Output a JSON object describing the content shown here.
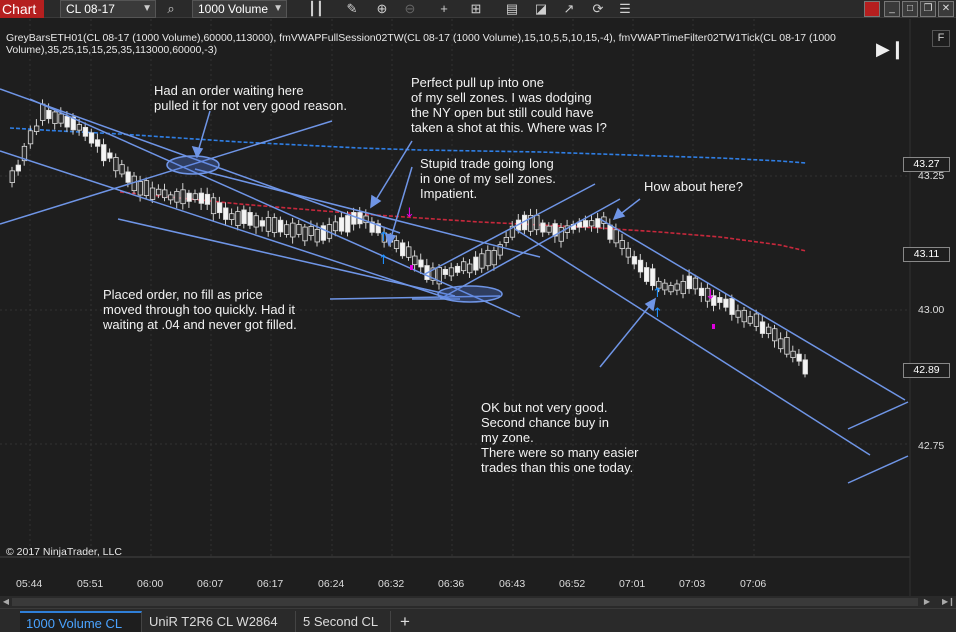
{
  "toolbar": {
    "chart_label": "Chart",
    "instrument": "CL 08-17",
    "interval": "1000 Volume"
  },
  "indicators_text": "GreyBarsETH01(CL 08-17 (1000 Volume),60000,113000), fmVWAPFullSession02TW(CL 08-17 (1000 Volume),15,10,5,5,10,15,-4), fmVWAPTimeFilter02TW1Tick(CL 08-17 (1000 Volume),35,25,15,15,25,35,113000,60000,-3)",
  "f_button": "F",
  "copyright": "© 2017 NinjaTrader, LLC",
  "annotations": [
    "Had an order waiting here\npulled it for not very good reason.",
    "Perfect pull up into one\nof my sell zones. I was dodging\nthe NY open but still could have\ntaken a shot at this. Where was I?",
    "Stupid trade going long\nin one of my sell zones.\nImpatient.",
    "How about here?",
    "Placed order, no fill as price\nmoved through too quickly. Had it\nwaiting at .04 and never got filled.",
    "OK but not very good.\nSecond chance buy in\nmy zone.\nThere were so many easier\ntrades than this one today."
  ],
  "price_axis": {
    "labels": [
      "43.25",
      "43.00",
      "42.75"
    ],
    "markers": [
      "43.27",
      "43.11",
      "42.89"
    ]
  },
  "time_axis": [
    "05:44",
    "05:51",
    "06:00",
    "06:07",
    "06:17",
    "06:24",
    "06:32",
    "06:36",
    "06:43",
    "06:52",
    "07:01",
    "07:03",
    "07:06"
  ],
  "tabs": [
    "1000 Volume CL",
    "UniR T2R6 CL W2864",
    "5 Second CL"
  ],
  "colors": {
    "accent_red": "#b51f1f",
    "active_tab": "#4aa3ff",
    "vwap_blue": "#2f7fe6",
    "vwap_red": "#c8283c",
    "trendline": "#6f95e6",
    "buy_arrow": "#1e90ff",
    "sell_arrow": "#e000e0"
  }
}
